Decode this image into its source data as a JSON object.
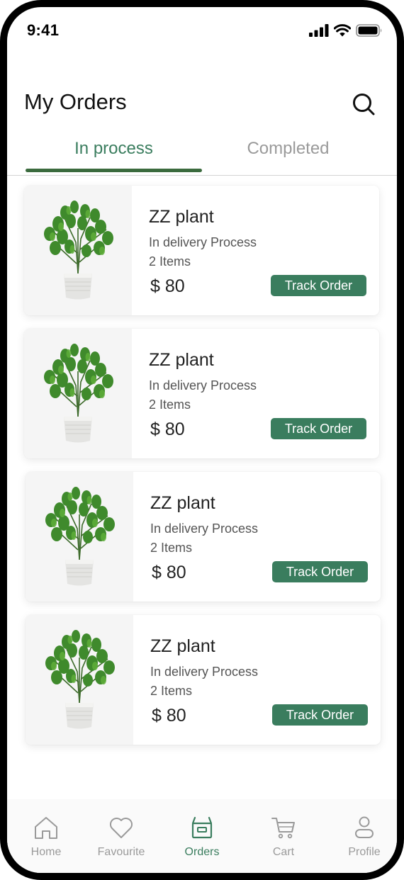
{
  "status_bar": {
    "time": "9:41"
  },
  "header": {
    "title": "My Orders"
  },
  "tabs": [
    {
      "label": "In process",
      "active": true
    },
    {
      "label": "Completed",
      "active": false
    }
  ],
  "orders": [
    {
      "name": "ZZ plant",
      "status": "In delivery Process",
      "items": "2 Items",
      "price": "$ 80",
      "action": "Track Order"
    },
    {
      "name": "ZZ plant",
      "status": "In delivery Process",
      "items": "2 Items",
      "price": "$ 80",
      "action": "Track Order"
    },
    {
      "name": "ZZ plant",
      "status": "In delivery Process",
      "items": "2 Items",
      "price": "$ 80",
      "action": "Track Order"
    },
    {
      "name": "ZZ plant",
      "status": "In delivery Process",
      "items": "2 Items",
      "price": "$ 80",
      "action": "Track Order"
    }
  ],
  "bottom_nav": [
    {
      "label": "Home",
      "icon": "home-icon",
      "active": false
    },
    {
      "label": "Favourite",
      "icon": "heart-icon",
      "active": false
    },
    {
      "label": "Orders",
      "icon": "orders-box-icon",
      "active": true
    },
    {
      "label": "Cart",
      "icon": "cart-icon",
      "active": false
    },
    {
      "label": "Profile",
      "icon": "profile-icon",
      "active": false
    }
  ],
  "colors": {
    "accent": "#3a7d5e",
    "tab_indicator": "#3b6b3e",
    "inactive": "#9a9a9a"
  }
}
